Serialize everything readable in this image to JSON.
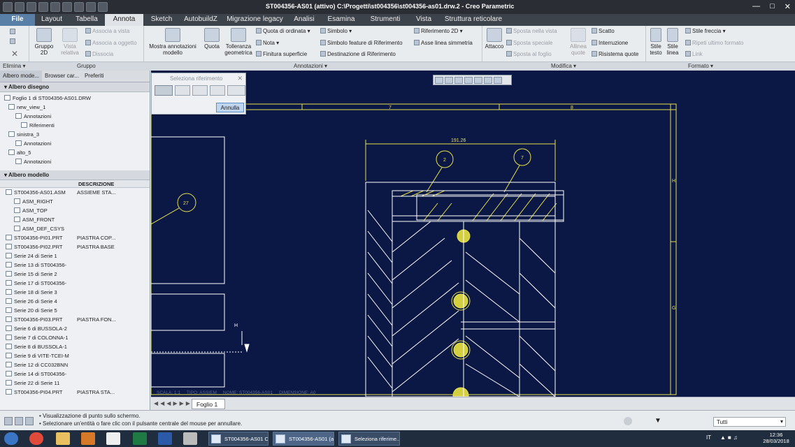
{
  "window": {
    "title": "ST004356-AS01 (attivo) C:\\Progetti\\st004356\\st004356-as01.drw.2 - Creo Parametric"
  },
  "menu": [
    "File",
    "Layout",
    "Tabella",
    "Annota",
    "Sketch",
    "AutobuildZ",
    "Migrazione legacy",
    "Analisi",
    "Esamina",
    "Strumenti",
    "Vista",
    "Struttura reticolare"
  ],
  "ribbon": {
    "elimina": "Elimina",
    "gruppo_2d": "Gruppo 2D",
    "vista_relativa": "Vista relativa",
    "associa_vista": "Associa a vista",
    "associa_oggetto": "Associa a oggetto",
    "dissocia": "Dissocia",
    "gruppo": "Gruppo",
    "mostra_annotazioni": "Mostra annotazioni modello",
    "quota": "Quota",
    "tolleranza": "Tolleranza geometrica",
    "quota_ordinata": "Quota di ordinata",
    "nota": "Nota",
    "finitura": "Finitura superficie",
    "simbolo": "Simbolo",
    "simbolo_feature": "Simbolo feature di Riferimento",
    "destinazione": "Destinazione di Riferimento",
    "riferimento_2d": "Riferimento 2D",
    "asse_linea": "Asse linea simmetria",
    "annotazioni": "Annotazioni",
    "attacco": "Attacco",
    "sposta_vista": "Sposta nella vista",
    "sposta_speciale": "Sposta speciale",
    "sposta_foglio": "Sposta al foglio",
    "allinea_quote": "Allinea quote",
    "scatto": "Scatto",
    "interruzione": "Interruzione",
    "ristema_quote": "Risistema quote",
    "modifica": "Modifica",
    "stile_testo": "Stile testo",
    "stile_linea": "Stile linea",
    "stile_freccia": "Stile freccia",
    "ripeti_formato": "Ripeti ultimo formato",
    "link": "Link",
    "formato": "Formato"
  },
  "panel": {
    "tabs": [
      "Albero mode...",
      "Browser car...",
      "Preferiti"
    ],
    "drawing_tree_title": "Albero disegno",
    "drawing_tree": [
      "Foglio 1 di ST004356-AS01.DRW",
      "new_view_1",
      "Annotazioni",
      "Riferimenti",
      "sinistra_3",
      "Annotazioni",
      "alto_5",
      "Annotazioni"
    ],
    "model_tree_title": "Albero modello",
    "col_descrizione": "DESCRIZIONE",
    "model_rows": [
      {
        "name": "ST004356-AS01.ASM",
        "desc": "ASSIEME STA..."
      },
      {
        "name": "ASM_RIGHT",
        "desc": ""
      },
      {
        "name": "ASM_TOP",
        "desc": ""
      },
      {
        "name": "ASM_FRONT",
        "desc": ""
      },
      {
        "name": "ASM_DEF_CSYS",
        "desc": ""
      },
      {
        "name": "ST004356-PI01.PRT",
        "desc": "PIASTRA COP..."
      },
      {
        "name": "ST004356-PI02.PRT",
        "desc": "PIASTRA BASE"
      },
      {
        "name": "Serie 24 di Serie 1",
        "desc": ""
      },
      {
        "name": "Serie 13 di ST004356-",
        "desc": ""
      },
      {
        "name": "Serie 15 di Serie 2",
        "desc": ""
      },
      {
        "name": "Serie 17 di ST004356-",
        "desc": ""
      },
      {
        "name": "Serie 18 di Serie 3",
        "desc": ""
      },
      {
        "name": "Serie 26 di Serie 4",
        "desc": ""
      },
      {
        "name": "Serie 20 di Serie 5",
        "desc": ""
      },
      {
        "name": "ST004356-PI03.PRT",
        "desc": "PIASTRA FON..."
      },
      {
        "name": "Serie 6 di BUSSOLA-2",
        "desc": ""
      },
      {
        "name": "Serie 7 di COLONNA-1",
        "desc": ""
      },
      {
        "name": "Serie 8 di BUSSOLA-1",
        "desc": ""
      },
      {
        "name": "Serie 9 di VITE-TCEI-M",
        "desc": ""
      },
      {
        "name": "Serie 12 di CC032BNN",
        "desc": ""
      },
      {
        "name": "Serie 14 di ST004356-",
        "desc": ""
      },
      {
        "name": "Serie 22 di Serie 11",
        "desc": ""
      },
      {
        "name": "ST004356-PI04.PRT",
        "desc": "PIASTRA STA..."
      }
    ]
  },
  "selezione": {
    "title": "Seleziona riferimento",
    "annulla": "Annulla"
  },
  "drawing": {
    "dim_191": "191.26",
    "balloon_2": "2",
    "balloon_7": "7",
    "balloon_27": "27",
    "col_7": "7",
    "col_8": "8",
    "row_h_label": "H",
    "row_g_label": "G",
    "h_marker": "H",
    "footer": "SCALA: 1:1     TIPO: ASSIEM     NOME: ST004356-AS01     DIMENSIONE: A0"
  },
  "sheet": {
    "tab": "Foglio 1"
  },
  "status": {
    "line1": "• Visualizzazione di punto sullo schermo.",
    "line2": "• Selezionare un'entità o fare clic con il pulsante centrale del mouse per annullare.",
    "filter": "Tutti"
  },
  "taskbar": {
    "tasks": [
      "ST004356-AS01 C...",
      "ST004356-AS01 (a...",
      "Seleziona riferime..."
    ],
    "lang": "IT",
    "time": "12:36",
    "date": "28/03/2018"
  },
  "colors": {
    "canvas": "#0b1845",
    "line": "#ffffff",
    "dim": "#e6e04a",
    "accent_file": "#5a7fa6"
  }
}
